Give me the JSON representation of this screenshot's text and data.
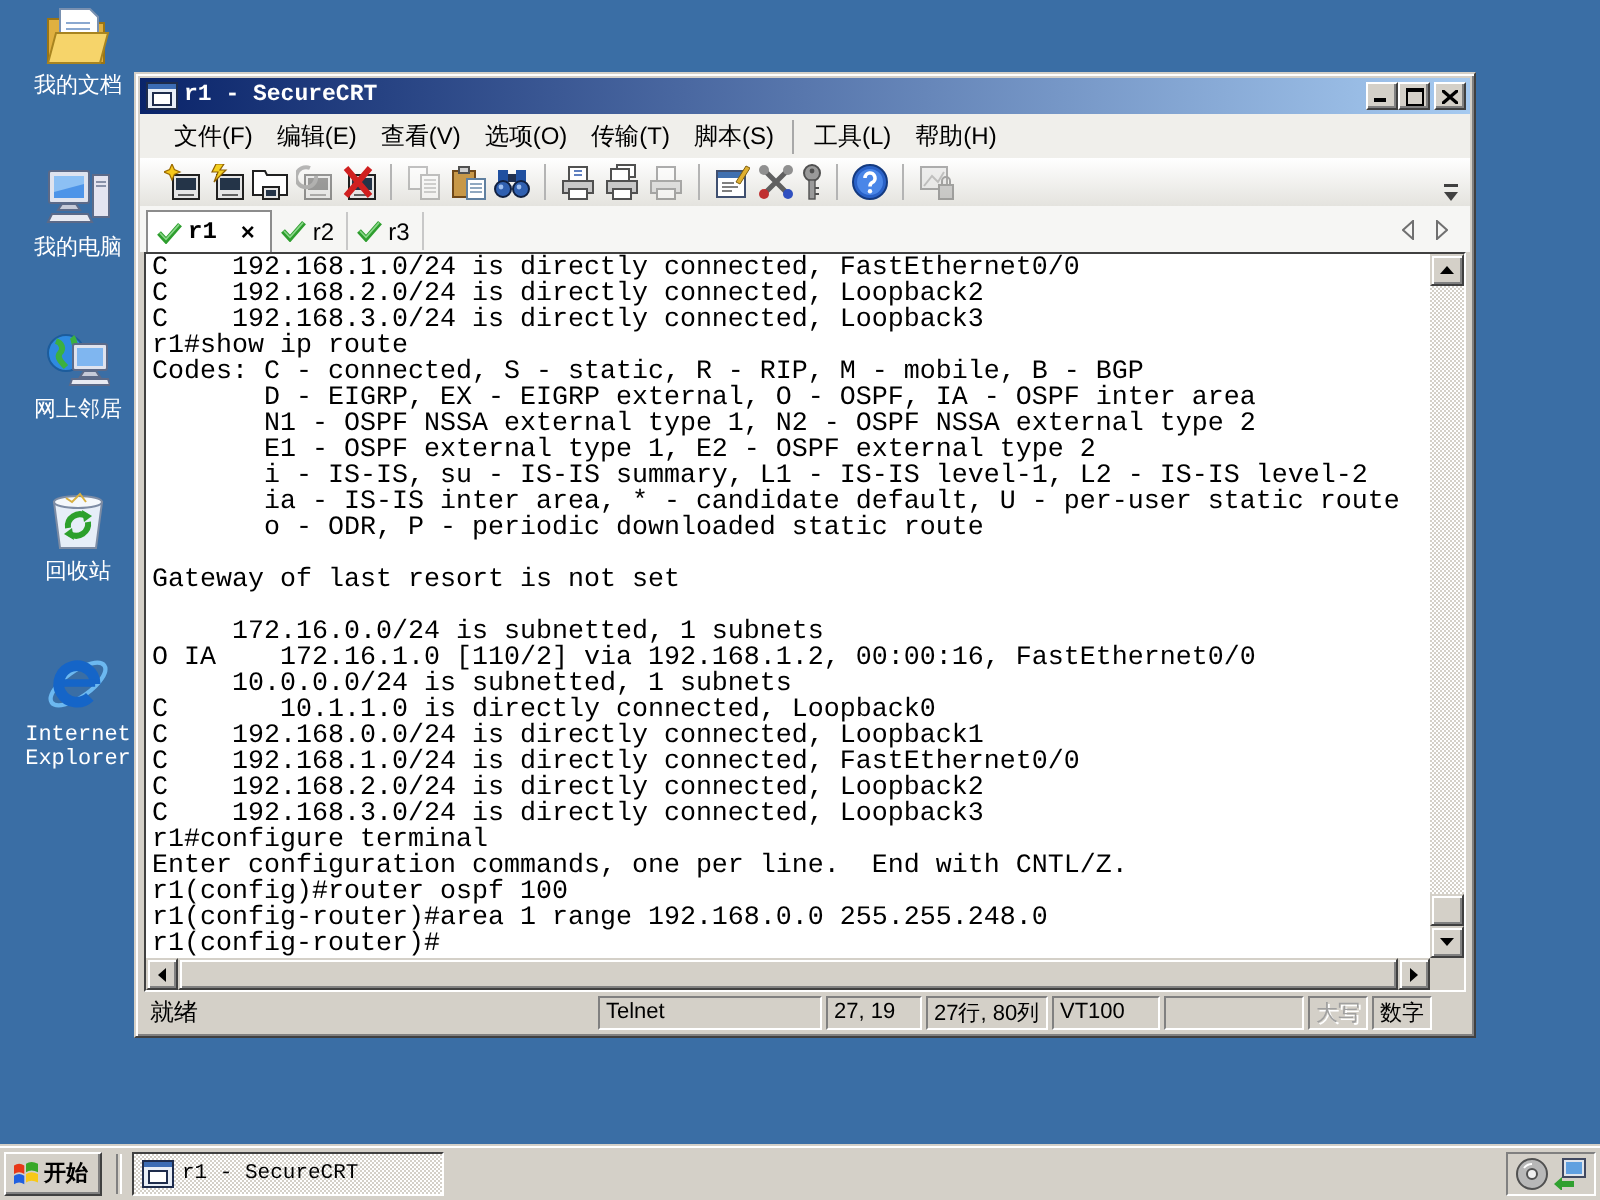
{
  "desktop_icons": [
    {
      "label": "我的文档"
    },
    {
      "label": "我的电脑"
    },
    {
      "label": "网上邻居"
    },
    {
      "label": "回收站"
    },
    {
      "label": "Internet Explorer"
    }
  ],
  "window": {
    "title": "r1 - SecureCRT"
  },
  "menu": {
    "groups": [
      {
        "items": [
          "文件(F)",
          "编辑(E)",
          "查看(V)",
          "选项(O)",
          "传输(T)",
          "脚本(S)"
        ]
      },
      {
        "items": [
          "工具(L)",
          "帮助(H)"
        ]
      }
    ]
  },
  "toolbar": {
    "groups": [
      {
        "buttons": [
          {
            "disabled": false
          },
          {
            "disabled": false
          },
          {
            "disabled": false
          },
          {
            "disabled": true
          },
          {
            "disabled": false
          }
        ]
      },
      {
        "buttons": [
          {
            "disabled": true
          },
          {
            "disabled": false
          },
          {
            "disabled": false
          }
        ]
      },
      {
        "buttons": [
          {
            "disabled": false
          },
          {
            "disabled": false
          },
          {
            "disabled": true
          }
        ]
      },
      {
        "buttons": [
          {
            "disabled": false
          },
          {
            "disabled": false
          },
          {
            "disabled": false
          }
        ]
      },
      {
        "buttons": [
          {
            "disabled": false
          }
        ]
      },
      {
        "buttons": [
          {
            "disabled": true
          }
        ]
      }
    ]
  },
  "tabs": [
    {
      "label": "r1",
      "selected": true,
      "connected": true,
      "close": "×"
    },
    {
      "label": "r2",
      "selected": false,
      "connected": true
    },
    {
      "label": "r3",
      "selected": false,
      "connected": true
    }
  ],
  "terminal": {
    "blocks": [
      {
        "lines": [
          "C    192.168.1.0/24 is directly connected, FastEthernet0/0",
          "C    192.168.2.0/24 is directly connected, Loopback2",
          "C    192.168.3.0/24 is directly connected, Loopback3",
          "r1#show ip route",
          "Codes: C - connected, S - static, R - RIP, M - mobile, B - BGP",
          "       D - EIGRP, EX - EIGRP external, O - OSPF, IA - OSPF inter area",
          "       N1 - OSPF NSSA external type 1, N2 - OSPF NSSA external type 2",
          "       E1 - OSPF external type 1, E2 - OSPF external type 2",
          "       i - IS-IS, su - IS-IS summary, L1 - IS-IS level-1, L2 - IS-IS level-2",
          "       ia - IS-IS inter area, * - candidate default, U - per-user static route",
          "       o - ODR, P - periodic downloaded static route"
        ]
      },
      {
        "lines": [
          "Gateway of last resort is not set"
        ]
      },
      {
        "lines": [
          "     172.16.0.0/24 is subnetted, 1 subnets",
          "O IA    172.16.1.0 [110/2] via 192.168.1.2, 00:00:16, FastEthernet0/0",
          "     10.0.0.0/24 is subnetted, 1 subnets",
          "C       10.1.1.0 is directly connected, Loopback0",
          "C    192.168.0.0/24 is directly connected, Loopback1",
          "C    192.168.1.0/24 is directly connected, FastEthernet0/0",
          "C    192.168.2.0/24 is directly connected, Loopback2",
          "C    192.168.3.0/24 is directly connected, Loopback3",
          "r1#configure terminal",
          "Enter configuration commands, one per line.  End with CNTL/Z.",
          "r1(config)#router ospf 100",
          "r1(config-router)#area 1 range 192.168.0.0 255.255.248.0",
          "r1(config-router)#"
        ]
      }
    ]
  },
  "status_bar": {
    "message": "就绪",
    "panels": [
      "Telnet",
      "27, 19",
      "27行, 80列",
      "VT100"
    ],
    "indicators": [
      {
        "label": "大写",
        "on": false
      },
      {
        "label": "数字",
        "on": true
      }
    ]
  },
  "taskbar": {
    "start": "开始",
    "tasks": [
      {
        "label": "r1 - SecureCRT",
        "selected": true
      }
    ]
  }
}
